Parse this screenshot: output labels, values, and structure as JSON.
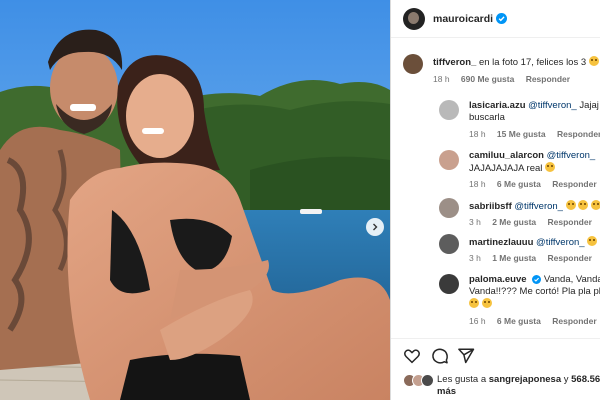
{
  "post": {
    "username": "mauroicardi"
  },
  "comments": [
    {
      "user": "tiffveron_",
      "mention": "",
      "text": "en la foto 17, felices los 3",
      "text2": "",
      "time": "18 h",
      "likes": "690 Me gusta",
      "reply": "Responder",
      "emoji_after": true,
      "avatar_color": "#6b4f3a"
    },
    {
      "user": "lasicaria.azu",
      "mention": "@tiffveron_",
      "text": "Jajaj t",
      "text2": "buscarla",
      "time": "18 h",
      "likes": "15 Me gusta",
      "reply": "Responder",
      "emoji_after": false,
      "avatar_color": "#b9b9b9"
    },
    {
      "user": "camiluu_alarcon",
      "mention": "@tiffveron_",
      "text": "",
      "text2": "JAJAJAJAJA real",
      "time": "18 h",
      "likes": "6 Me gusta",
      "reply": "Responder",
      "emoji_after": true,
      "avatar_color": "#c9a08e"
    },
    {
      "user": "sabriibsff",
      "mention": "@tiffveron_",
      "text": "",
      "text2": "",
      "time": "3 h",
      "likes": "2 Me gusta",
      "reply": "Responder",
      "emoji_after": true,
      "avatar_color": "#9c8f87"
    },
    {
      "user": "martinezlauuu",
      "mention": "@tiffveron_",
      "text": "",
      "text2": "",
      "time": "3 h",
      "likes": "1 Me gusta",
      "reply": "Responder",
      "emoji_after": true,
      "avatar_color": "#5d5d5d"
    },
    {
      "user": "paloma.euve",
      "mention": "",
      "text": "Vanda, Vanda,",
      "text2": "Vanda!!??? Me cortó! Pla pla pl",
      "time": "16 h",
      "likes": "6 Me gusta",
      "reply": "Responder",
      "emoji_after": false,
      "verified": true,
      "avatar_color": "#3a3a3a"
    }
  ],
  "likes_summary": {
    "prefix": "Les gusta a",
    "user": "sangrejaponesa",
    "middle": "y",
    "count": "568.569",
    "suffix": "más"
  },
  "colors": {
    "sky": "#5aa0ea",
    "link": "#00376b",
    "verified": "#0095f6",
    "muted": "#737373"
  }
}
